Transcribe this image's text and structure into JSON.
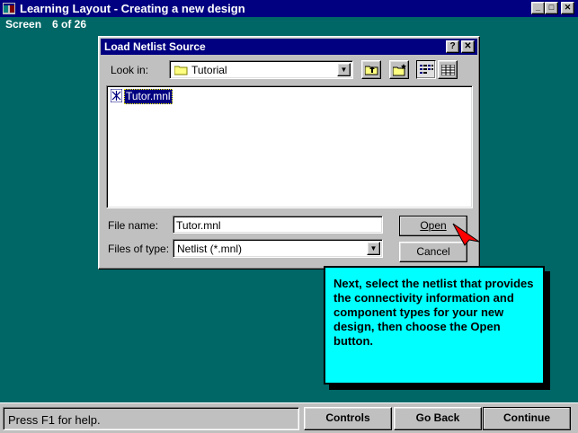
{
  "window": {
    "title": "Learning Layout - Creating a new design"
  },
  "screen": {
    "label": "Screen",
    "count": "6  of 26"
  },
  "dialog": {
    "title": "Load Netlist Source",
    "look_in_label": "Look in:",
    "look_in_value": "Tutorial",
    "files": [
      {
        "name": "Tutor.mnl"
      }
    ],
    "file_name_label": "File name:",
    "file_name_value": "Tutor.mnl",
    "files_of_type_label": "Files of type:",
    "files_of_type_value": "Netlist (*.mnl)",
    "open_label": "Open",
    "cancel_label": "Cancel"
  },
  "callout": {
    "text": "Next, select the netlist that provides the connectivity information and component types for your new design, then choose the Open button."
  },
  "status": {
    "help_text": "Press F1 for help."
  },
  "nav": {
    "controls_label": "Controls",
    "goback_label": "Go Back",
    "continue_label": "Continue"
  },
  "colors": {
    "desktop": "#006666",
    "titlebar": "#000080",
    "callout": "#00ffff",
    "face": "#c0c0c0"
  }
}
